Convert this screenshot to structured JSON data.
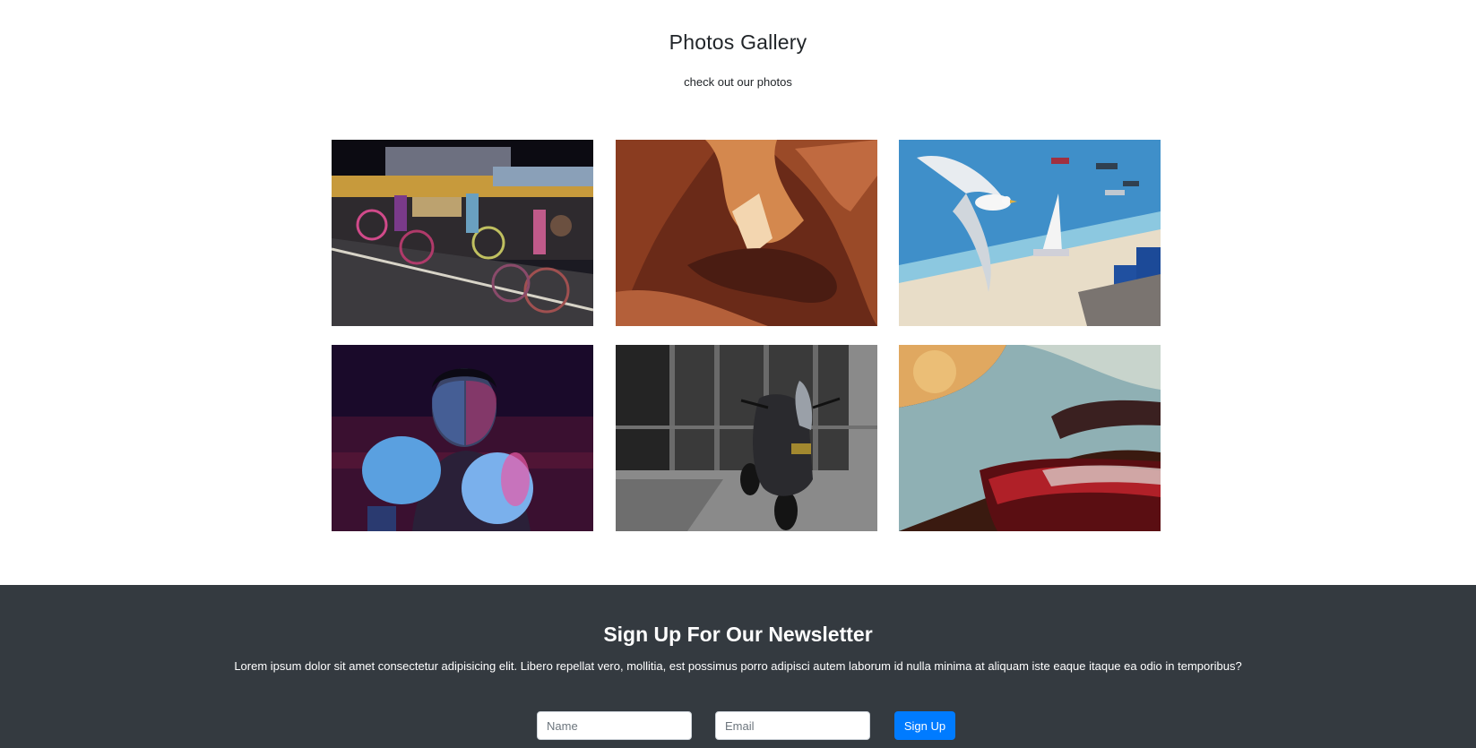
{
  "gallery": {
    "title": "Photos Gallery",
    "subtitle": "check out our photos",
    "photos": [
      {
        "subject": "night-cyclists-photo"
      },
      {
        "subject": "canyon-photo"
      },
      {
        "subject": "seagull-beach-photo"
      },
      {
        "subject": "boxer-photo"
      },
      {
        "subject": "motorcycle-photo"
      },
      {
        "subject": "car-taillight-photo"
      }
    ]
  },
  "newsletter": {
    "title": "Sign Up For Our Newsletter",
    "text": "Lorem ipsum dolor sit amet consectetur adipisicing elit. Libero repellat vero, mollitia, est possimus porro adipisci autem laborum id nulla minima at aliquam iste eaque itaque ea odio in temporibus?",
    "name_placeholder": "Name",
    "email_placeholder": "Email",
    "button_label": "Sign Up"
  },
  "colors": {
    "footer_bg": "#343a40",
    "button_bg": "#007bff"
  }
}
